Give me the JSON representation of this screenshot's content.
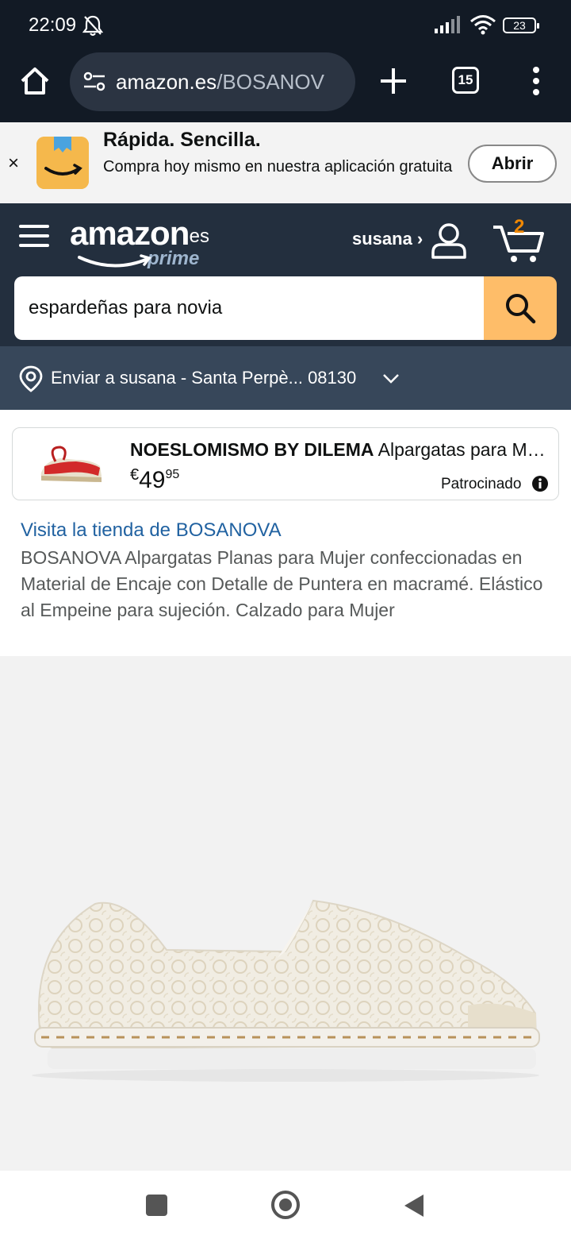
{
  "status_bar": {
    "time": "22:09",
    "battery": "23"
  },
  "browser": {
    "url_domain": "amazon.es",
    "url_path": "/BOSANOV",
    "tab_count": "15"
  },
  "app_banner": {
    "title": "Rápida. Sencilla.",
    "description": "Compra hoy mismo en nuestra aplicación gratuita",
    "open_label": "Abrir",
    "close_label": "×"
  },
  "header": {
    "logo_text": "amazon",
    "logo_tld": ".es",
    "logo_prime": "prime",
    "user_label": "susana ›",
    "cart_count": "2"
  },
  "search": {
    "value": "espardeñas para novia"
  },
  "delivery": {
    "text": "Enviar a susana - Santa Perpè... 08130"
  },
  "sponsored": {
    "brand": "NOESLOMISMO BY DILEMA",
    "title": "Alpargatas para Mujer",
    "price_currency": "€",
    "price_whole": "49",
    "price_fraction": "95",
    "badge": "Patrocinado"
  },
  "product": {
    "store_link": "Visita la tienda de BOSANOVA",
    "title": "BOSANOVA Alpargatas Planas para Mujer confeccionadas en Material de Encaje con Detalle de Puntera en macramé. Elástico al Empeine para sujeción. Calzado para Mujer"
  },
  "colors": {
    "browser_bg": "#121a25",
    "amazon_header": "#232f3e",
    "delivery_bar": "#37475a",
    "search_button": "#febd69",
    "link": "#2162a1",
    "cart_count": "#f08804"
  }
}
